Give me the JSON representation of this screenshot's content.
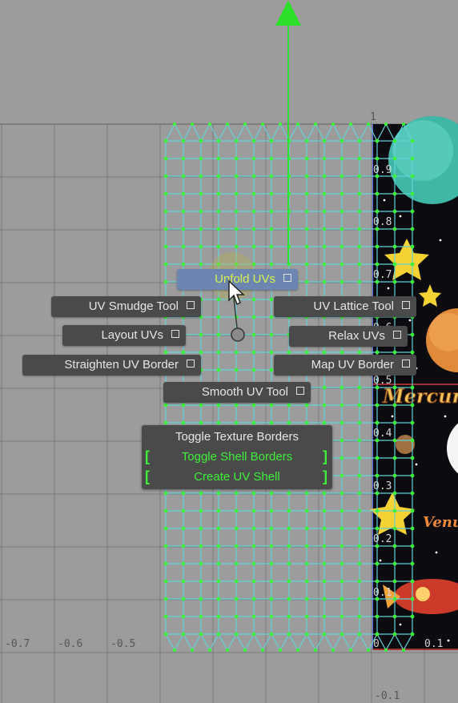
{
  "viewport": {
    "axis_labels_bottom": [
      "-0.7",
      "-0.6",
      "-0.5",
      "0",
      "0.1"
    ],
    "axis_labels_side": [
      "1",
      "0.9",
      "0.8",
      "0.7",
      "0.6",
      "0.5",
      "0.4",
      "0.3",
      "0.2",
      "0.1",
      "-0.1"
    ],
    "texture_text": {
      "planet_name_1": "Mercur",
      "planet_name_2": "Venu"
    },
    "colors": {
      "background": "#9c9c9c",
      "grid_line": "#7a7a7a",
      "uv_edge": "#62d3d8",
      "uv_vertex": "#3ef03a",
      "manipulator": "#2de02c",
      "texture_bg": "#0b0b10"
    }
  },
  "marking_menu": {
    "items": [
      {
        "id": "unfold-uvs",
        "label": "Unfold UVs",
        "active": true
      },
      {
        "id": "uv-smudge-tool",
        "label": "UV Smudge Tool"
      },
      {
        "id": "uv-lattice-tool",
        "label": "UV Lattice Tool"
      },
      {
        "id": "layout-uvs",
        "label": "Layout UVs"
      },
      {
        "id": "relax-uvs",
        "label": "Relax UVs"
      },
      {
        "id": "straighten-uv-border",
        "label": "Straighten UV Border"
      },
      {
        "id": "map-uv-border",
        "label": "Map UV Border"
      },
      {
        "id": "smooth-uv-tool",
        "label": "Smooth UV Tool"
      }
    ]
  },
  "context_menu": {
    "toggle_texture_borders": "Toggle Texture Borders",
    "toggle_shell_borders": "Toggle Shell Borders",
    "create_uv_shell": "Create UV Shell",
    "bracket_left": "[",
    "bracket_right": "]"
  }
}
